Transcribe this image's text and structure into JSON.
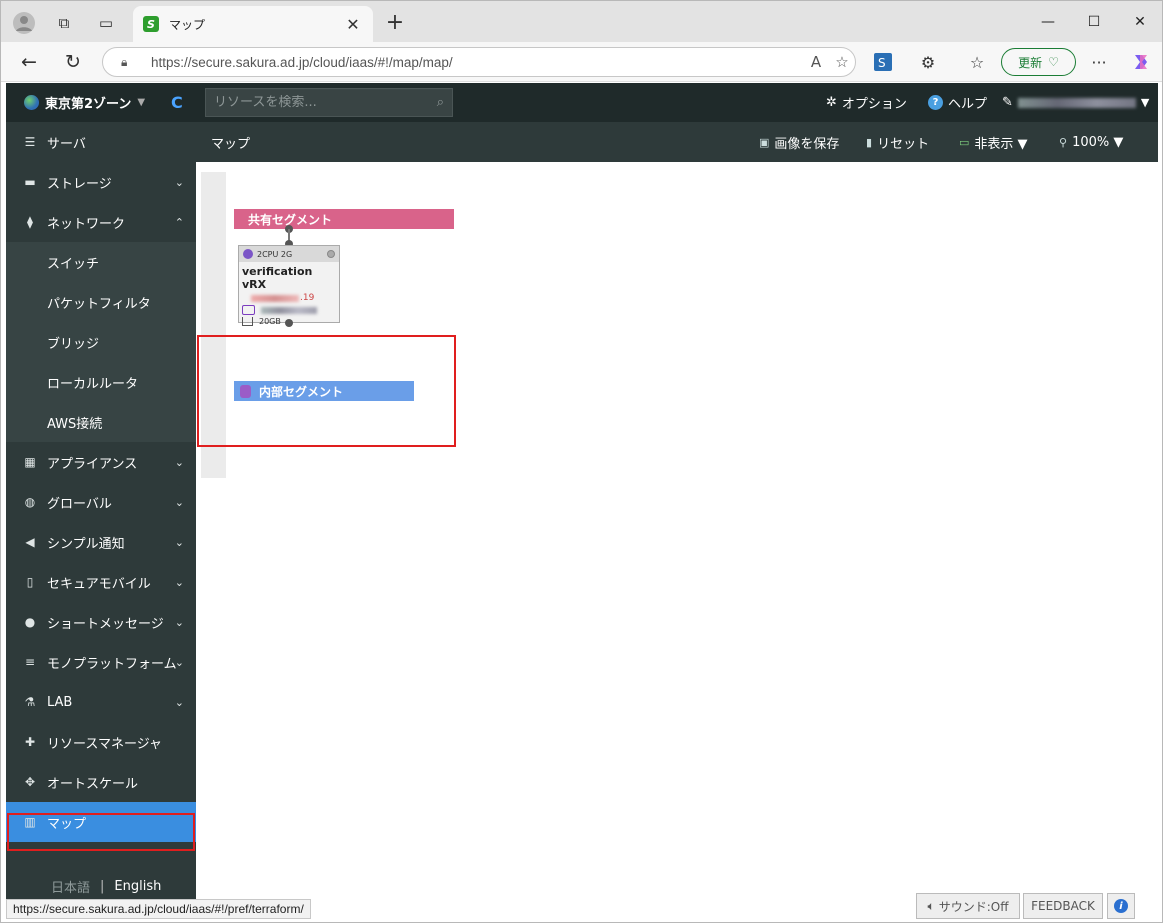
{
  "browser": {
    "tab_title": "マップ",
    "url": "https://secure.sakura.ad.jp/cloud/iaas/#!/map/map/",
    "update_label": "更新",
    "status_url": "https://secure.sakura.ad.jp/cloud/iaas/#!/pref/terraform/"
  },
  "header": {
    "zone": "東京第2ゾーン",
    "search_placeholder": "リソースを検索...",
    "options_label": "オプション",
    "help_label": "ヘルプ"
  },
  "sidebar": {
    "items": [
      {
        "label": "サーバ",
        "icon": "server-icon"
      },
      {
        "label": "ストレージ",
        "icon": "storage-icon"
      },
      {
        "label": "ネットワーク",
        "icon": "network-icon"
      },
      {
        "label": "アプライアンス",
        "icon": "appliance-icon"
      },
      {
        "label": "グローバル",
        "icon": "globe-icon"
      },
      {
        "label": "シンプル通知",
        "icon": "megaphone-icon"
      },
      {
        "label": "セキュアモバイル",
        "icon": "mobile-icon"
      },
      {
        "label": "ショートメッセージ",
        "icon": "chat-icon"
      },
      {
        "label": "モノプラットフォーム",
        "icon": "list-icon"
      },
      {
        "label": "LAB",
        "icon": "flask-icon"
      },
      {
        "label": "リソースマネージャ",
        "icon": "puzzle-icon"
      },
      {
        "label": "オートスケール",
        "icon": "move-icon"
      },
      {
        "label": "マップ",
        "icon": "map-icon"
      }
    ],
    "network_sub": [
      "スイッチ",
      "パケットフィルタ",
      "ブリッジ",
      "ローカルルータ",
      "AWS接続"
    ],
    "lang_ja": "日本語",
    "lang_sep": "|",
    "lang_en": "English"
  },
  "toolbar": {
    "title": "マップ",
    "save_image": "画像を保存",
    "reset": "リセット",
    "hide": "非表示 ▼",
    "zoom": "100% ▼"
  },
  "map": {
    "shared_segment": "共有セグメント",
    "internal_segment": "内部セグメント",
    "server": {
      "spec": "2CPU 2G",
      "name": "verification vRX",
      "ip_suffix": ".19",
      "disk": "20GB"
    }
  },
  "footer": {
    "sound": "サウンド:Off",
    "feedback": "FEEDBACK"
  },
  "colors": {
    "shared_segment": "#d9638a",
    "internal_segment": "#6a9ee8",
    "sidebar_active": "#3a8ee0",
    "highlight": "#e01e1e"
  }
}
